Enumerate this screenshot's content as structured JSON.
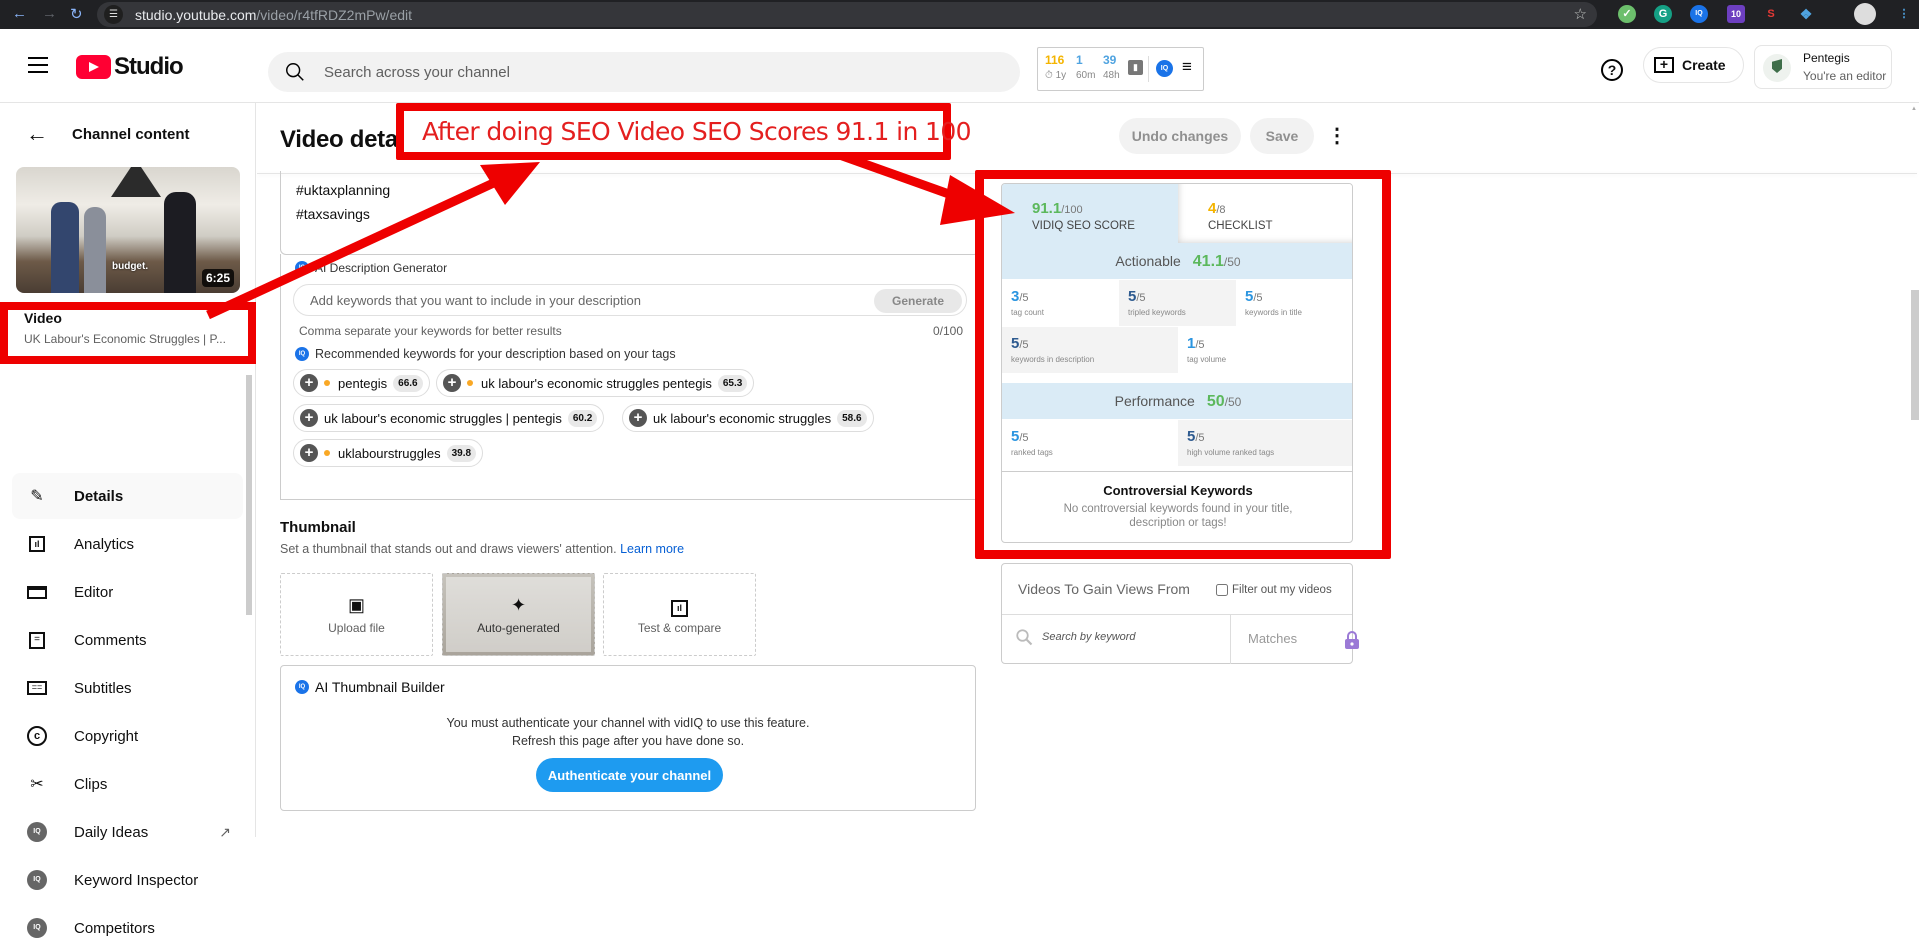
{
  "browser": {
    "url_host": "studio.youtube.com",
    "url_path": "/video/r4tfRDZ2mPw/edit",
    "extension_badge": "10"
  },
  "header": {
    "logo_text": "Studio",
    "search_placeholder": "Search across your channel",
    "vidiq_stats": [
      {
        "value": "116",
        "label": "1y",
        "color": "#f4b400"
      },
      {
        "value": "1",
        "label": "60m",
        "color": "#4fa3e0"
      },
      {
        "value": "39",
        "label": "48h",
        "color": "#4fa3e0"
      }
    ],
    "create_label": "Create",
    "account_name": "Pentegis",
    "account_role": "You're an editor"
  },
  "sidebar": {
    "back_label": "Channel content",
    "video_caption": "budget.",
    "video_duration": "6:25",
    "video_label": "Video",
    "video_title": "UK Labour's Economic Struggles | P...",
    "items": [
      {
        "label": "Details",
        "icon": "pencil-icon",
        "active": true
      },
      {
        "label": "Analytics",
        "icon": "analytics-icon"
      },
      {
        "label": "Editor",
        "icon": "editor-icon"
      },
      {
        "label": "Comments",
        "icon": "comments-icon"
      },
      {
        "label": "Subtitles",
        "icon": "subtitles-icon"
      },
      {
        "label": "Copyright",
        "icon": "copyright-icon"
      },
      {
        "label": "Clips",
        "icon": "scissors-icon"
      },
      {
        "label": "Daily Ideas",
        "icon": "vidiq-icon",
        "external": true
      },
      {
        "label": "Keyword Inspector",
        "icon": "vidiq-icon"
      },
      {
        "label": "Competitors",
        "icon": "vidiq-icon"
      }
    ]
  },
  "main": {
    "page_title": "Video details",
    "undo_label": "Undo changes",
    "save_label": "Save",
    "description_lines": [
      "#uktaxplanning",
      "#taxsavings"
    ],
    "ai_description": {
      "title": "AI Description Generator",
      "input_placeholder": "Add keywords that you want to include in your description",
      "generate_label": "Generate",
      "helper": "Comma separate your keywords for better results",
      "counter": "0/100",
      "recommended_title": "Recommended keywords for your description based on your tags",
      "keywords": [
        {
          "text": "pentegis",
          "score": "66.6",
          "dot": true
        },
        {
          "text": "uk labour's economic struggles pentegis",
          "score": "65.3",
          "dot": true
        },
        {
          "text": "uk labour's economic struggles | pentegis",
          "score": "60.2",
          "dot": false
        },
        {
          "text": "uk labour's economic struggles",
          "score": "58.6",
          "dot": false
        },
        {
          "text": "uklabourstruggles",
          "score": "39.8",
          "dot": true
        }
      ]
    },
    "thumbnail": {
      "title": "Thumbnail",
      "description": "Set a thumbnail that stands out and draws viewers' attention.",
      "learn_more": "Learn more",
      "options": [
        "Upload file",
        "Auto-generated",
        "Test & compare"
      ]
    },
    "ai_thumbnail": {
      "title": "AI Thumbnail Builder",
      "message_1": "You must authenticate your channel with vidIQ to use this feature.",
      "message_2": "Refresh this page after you have done so.",
      "button_label": "Authenticate your channel"
    }
  },
  "seo_panel": {
    "score_value": "91.1",
    "score_max": "/100",
    "score_label": "VIDIQ SEO SCORE",
    "checklist_value": "4",
    "checklist_max": "/8",
    "checklist_label": "CHECKLIST",
    "actionable": {
      "label": "Actionable",
      "value": "41.1",
      "max": "/50"
    },
    "actionable_metrics": [
      {
        "value": "3",
        "max": "/5",
        "label": "tag count"
      },
      {
        "value": "5",
        "max": "/5",
        "label": "tripled keywords"
      },
      {
        "value": "5",
        "max": "/5",
        "label": "keywords in title"
      },
      {
        "value": "5",
        "max": "/5",
        "label": "keywords in description"
      },
      {
        "value": "1",
        "max": "/5",
        "label": "tag volume"
      }
    ],
    "performance": {
      "label": "Performance",
      "value": "50",
      "max": "/50"
    },
    "performance_metrics": [
      {
        "value": "5",
        "max": "/5",
        "label": "ranked tags"
      },
      {
        "value": "5",
        "max": "/5",
        "label": "high volume ranked tags"
      }
    ],
    "controversial_title": "Controversial Keywords",
    "controversial_text": "No controversial keywords found in your title, description or tags!"
  },
  "gain_panel": {
    "title": "Videos To Gain Views From",
    "filter_label": "Filter out my videos",
    "search_placeholder": "Search by keyword",
    "matches_label": "Matches"
  },
  "annotation": {
    "text": "After doing SEO Video SEO Scores 91.1 in 100",
    "color": "#ee0000"
  },
  "colors": {
    "score_green": "#5cb85c",
    "checklist_yellow": "#f4b400",
    "metric_blue": "#2b95e0",
    "auth_blue": "#1e9bf0",
    "youtube_red": "#ff0033"
  }
}
